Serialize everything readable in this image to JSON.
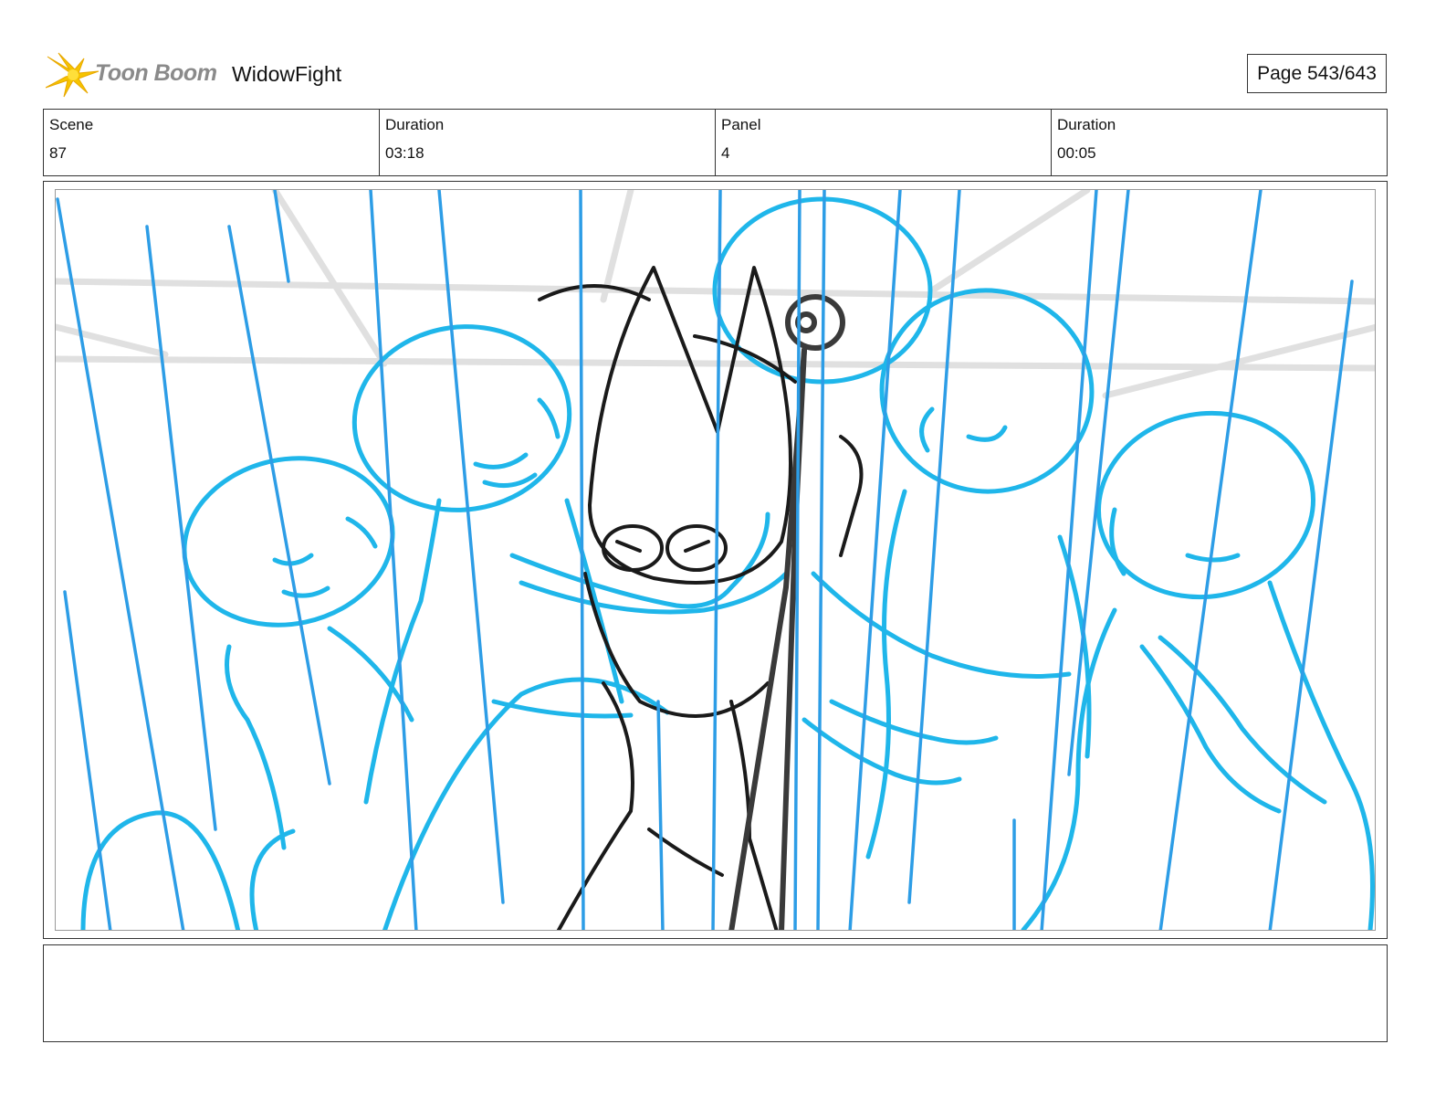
{
  "header": {
    "logo_text": "Toon Boom",
    "project_title": "WidowFight",
    "page_label": "Page 543/643"
  },
  "info": {
    "scene_label": "Scene",
    "scene_value": "87",
    "scene_duration_label": "Duration",
    "scene_duration_value": "03:18",
    "panel_label": "Panel",
    "panel_value": "4",
    "panel_duration_label": "Duration",
    "panel_duration_value": "00:05"
  },
  "notes": {
    "text": ""
  },
  "colors": {
    "sketch_blue": "#1fb6ea",
    "rain_blue": "#2d9de6",
    "ink": "#1a1a1a",
    "background_grey": "#e0e0e0",
    "logo_yellow": "#f6c400"
  }
}
